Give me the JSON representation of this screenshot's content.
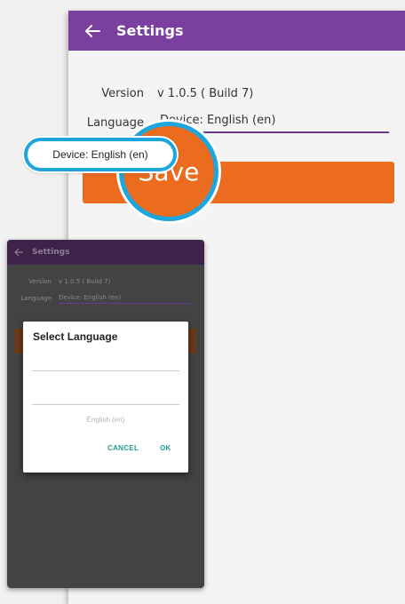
{
  "settings": {
    "title": "Settings",
    "version_label": "Version",
    "version_value": "v 1.0.5 ( Build 7)",
    "language_label": "Language",
    "language_value": "Device: English (en)",
    "save_label": "Save"
  },
  "phone": {
    "title": "Settings",
    "version_label": "Version",
    "version_value": "v 1.0.5 ( Build 7)",
    "language_label": "Language",
    "language_value": "Device: English (en)",
    "dialog": {
      "title": "Select Language",
      "options": [
        "Device: English (en)",
        "English (en)"
      ],
      "cancel_label": "CANCEL",
      "ok_label": "OK"
    }
  },
  "colors": {
    "appbar": "#7b3fa0",
    "accent_orange": "#eb6c1f",
    "highlight_ring": "#1da6de",
    "dialog_buttons": "#1f9e8e"
  },
  "icons": {
    "back": "back-arrow-icon"
  }
}
